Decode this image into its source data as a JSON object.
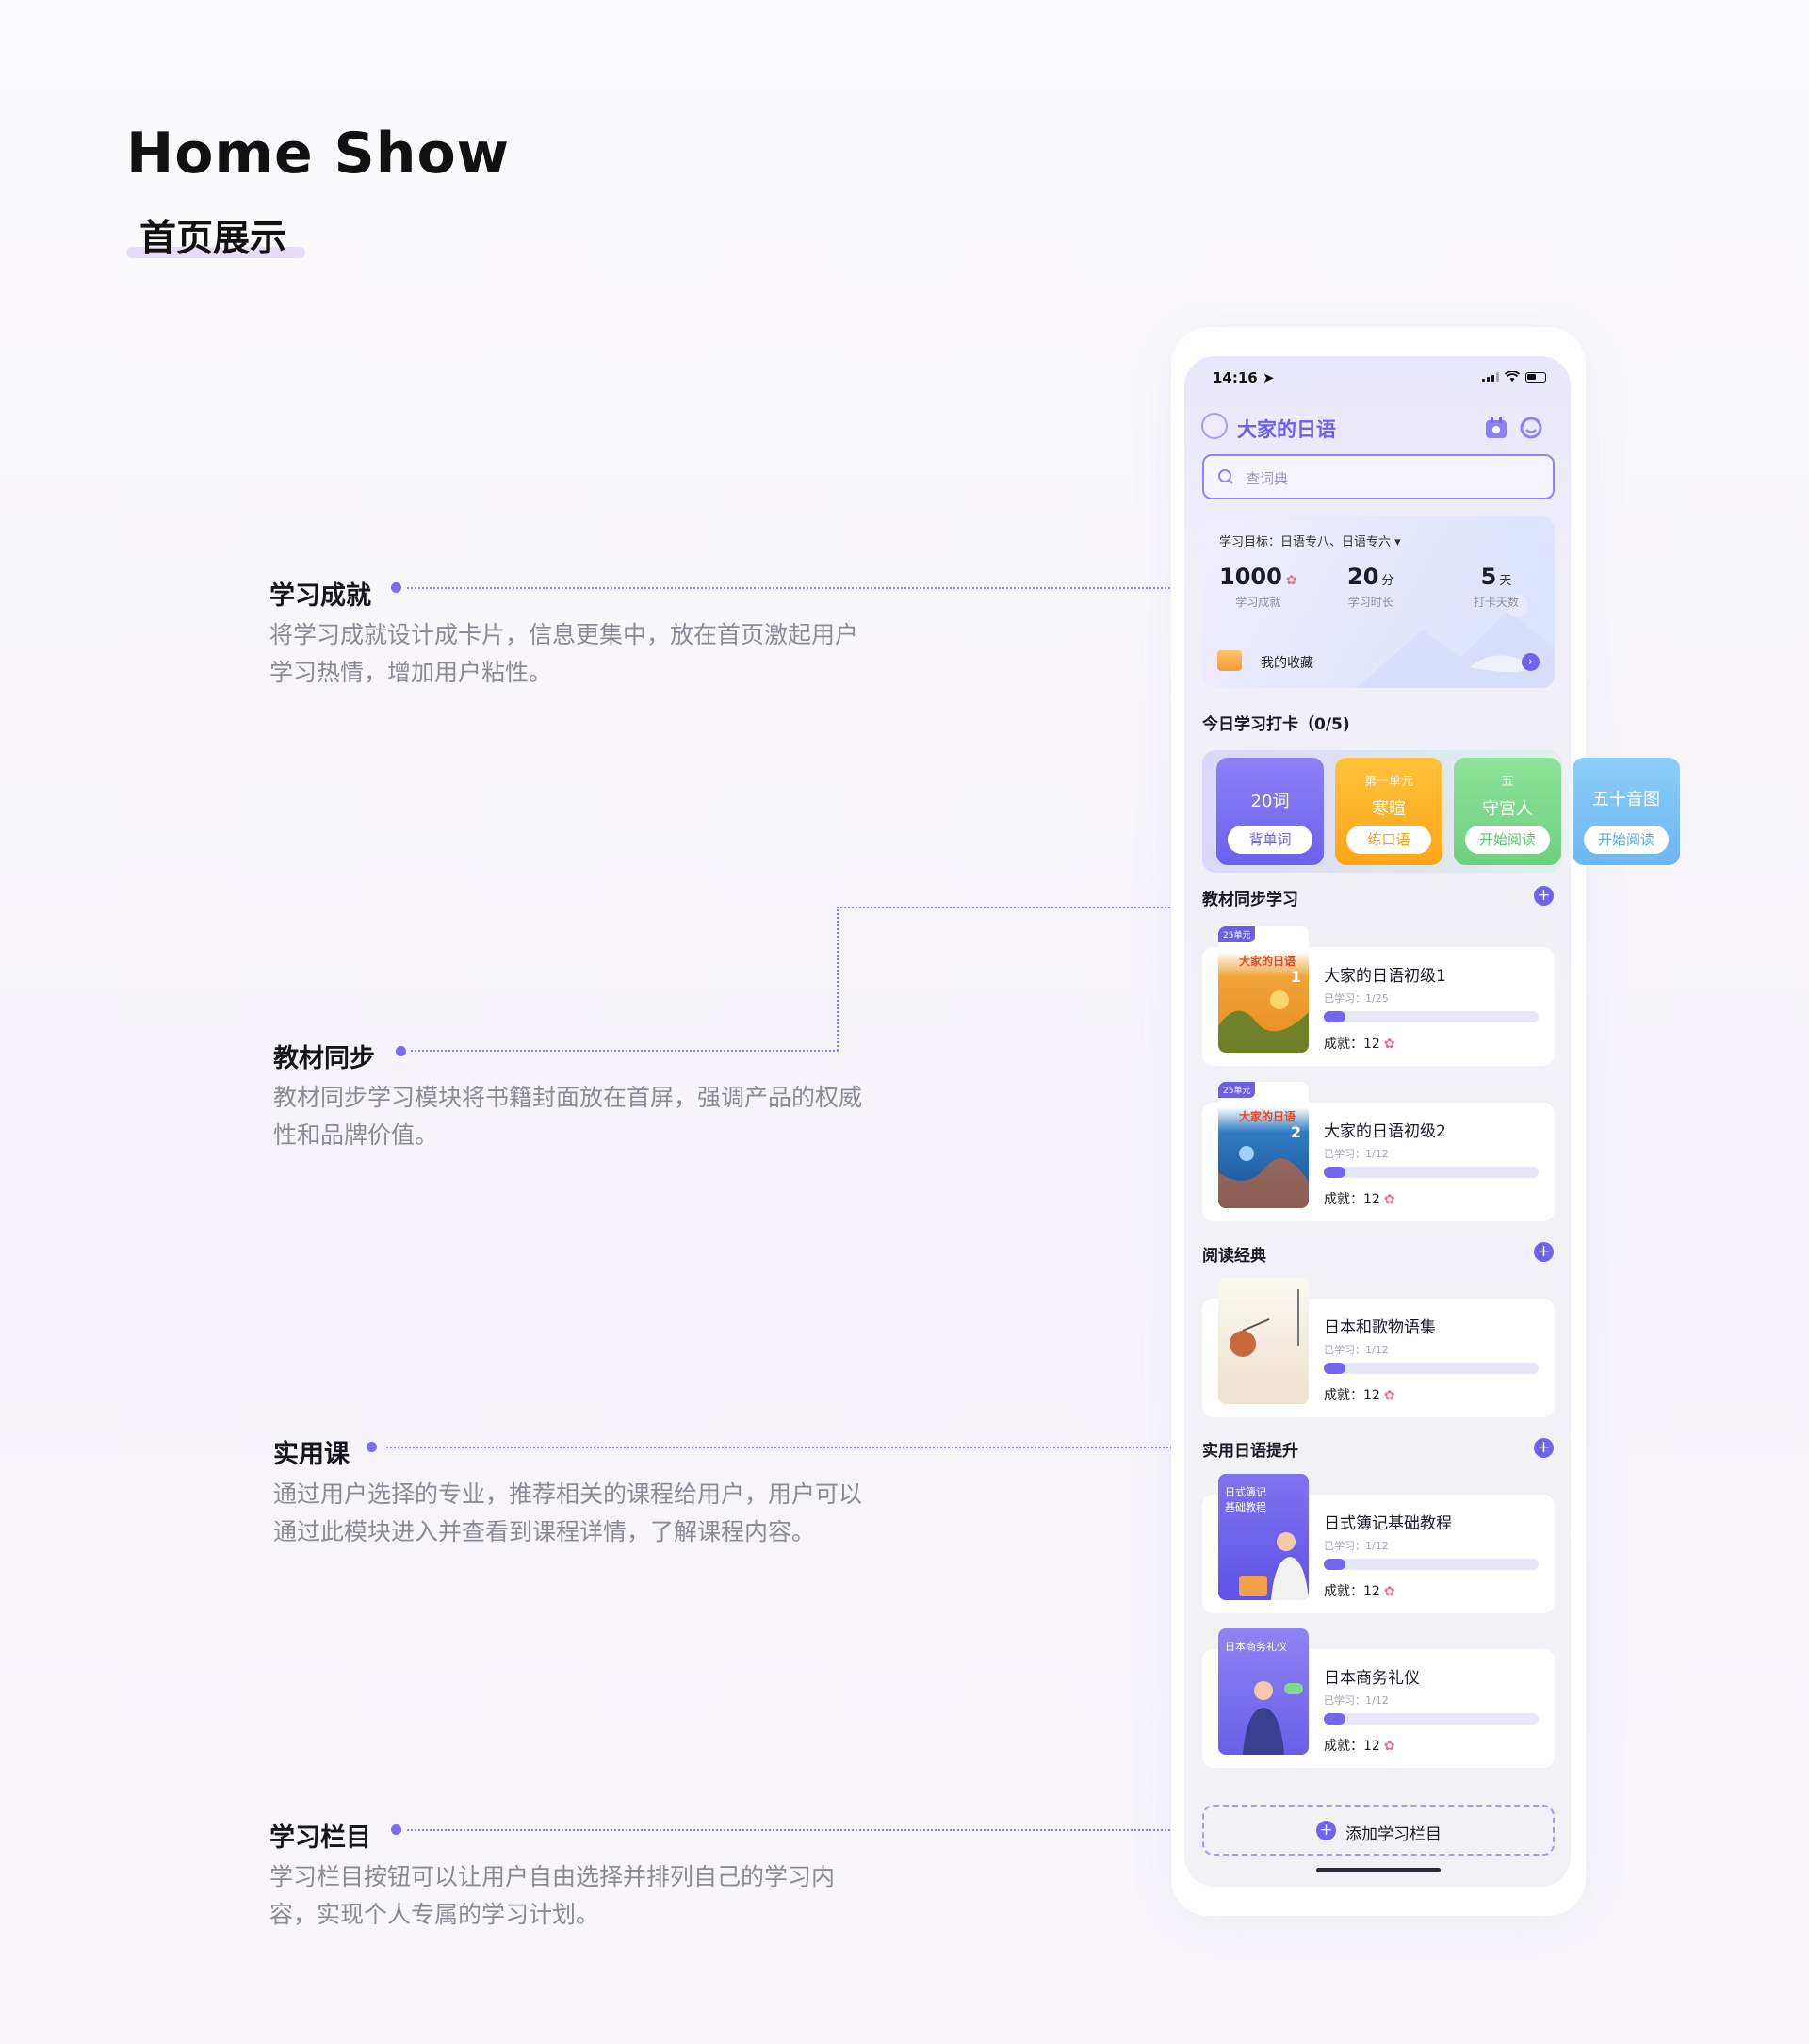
{
  "header": {
    "title": "Home  Show",
    "subtitle": "首页展示"
  },
  "annotations": [
    {
      "title": "学习成就",
      "desc": "将学习成就设计成卡片，信息更集中，放在首页激起用户学习热情，增加用户粘性。"
    },
    {
      "title": "教材同步",
      "desc": "教材同步学习模块将书籍封面放在首屏，强调产品的权威性和品牌价值。"
    },
    {
      "title": "实用课",
      "desc": "通过用户选择的专业，推荐相关的课程给用户，用户可以通过此模块进入并查看到课程详情，了解课程内容。"
    },
    {
      "title": "学习栏目",
      "desc": "学习栏目按钮可以让用户自由选择并排列自己的学习内容，实现个人专属的学习计划。"
    }
  ],
  "phone": {
    "status_time": "14:16",
    "app_name": "大家的日语",
    "search_placeholder": "查词典",
    "stats": {
      "goal": "学习目标：日语专八、日语专六",
      "achievement_value": "1000",
      "achievement_label": "学习成就",
      "time_value": "20",
      "time_unit": "分",
      "time_label": "学习时长",
      "days_value": "5",
      "days_unit": "天",
      "days_label": "打卡天数",
      "favorites": "我的收藏"
    },
    "checkin": {
      "title": "今日学习打卡（0/5)",
      "cards": [
        {
          "top": "",
          "main": "20词",
          "button": "背单词",
          "color": "#7c70ef"
        },
        {
          "top": "第一单元",
          "main": "寒暄",
          "button": "练口语",
          "color": "#ffb21f"
        },
        {
          "top": "五",
          "main": "守宫人",
          "button": "开始阅读",
          "color": "#7fd98e"
        },
        {
          "top": "",
          "main": "五十音图",
          "button": "开始阅读",
          "color": "#7fc2f5"
        }
      ]
    },
    "textbook": {
      "title": "教材同步学习",
      "items": [
        {
          "badge": "25单元",
          "cover_title": "大家的日语",
          "cover_num": "1",
          "name": "大家的日语初级1",
          "progress_text": "已学习：1/25",
          "progress": 0.1,
          "achievement": "成就：12"
        },
        {
          "badge": "25单元",
          "cover_title": "大家的日语",
          "cover_num": "2",
          "name": "大家的日语初级2",
          "progress_text": "已学习：1/12",
          "progress": 0.1,
          "achievement": "成就：12"
        }
      ]
    },
    "reading": {
      "title": "阅读经典",
      "items": [
        {
          "name": "日本和歌物语集",
          "progress_text": "已学习：1/12",
          "progress": 0.1,
          "achievement": "成就：12"
        }
      ]
    },
    "practical": {
      "title": "实用日语提升",
      "items": [
        {
          "cover_title": "日式簿记\n基础教程",
          "name": "日式簿记基础教程",
          "progress_text": "已学习：1/12",
          "progress": 0.1,
          "achievement": "成就：12"
        },
        {
          "cover_title": "日本商务礼仪",
          "name": "日本商务礼仪",
          "progress_text": "已学习：1/12",
          "progress": 0.1,
          "achievement": "成就：12"
        }
      ]
    },
    "add_column": "添加学习栏目"
  }
}
